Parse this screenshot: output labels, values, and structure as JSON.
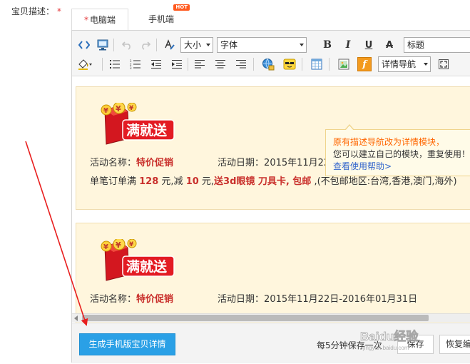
{
  "field": {
    "label": "宝贝描述：",
    "required_mark": "*"
  },
  "tabs": [
    {
      "label": "电脑端",
      "required_mark": "*",
      "active": true
    },
    {
      "label": "手机端",
      "badge": "HOT",
      "active": false
    }
  ],
  "toolbar": {
    "size_select": "大小",
    "font_select": "字体",
    "heading_select": "标题",
    "nav_select": "详情导航",
    "bold_label": "B",
    "italic_label": "I",
    "underline_label": "U",
    "strike_label": "A",
    "flash_label": "f"
  },
  "tooltip": {
    "line1": "原有描述导航改为详情模块，",
    "line2": "您可以建立自己的模块，重复使用！",
    "help_link": "查看使用帮助>"
  },
  "promos": [
    {
      "logo_text": "满就送",
      "name_label": "活动名称：",
      "name_value": "特价促销",
      "date_label": "活动日期：",
      "date_value": "2015年11月22日-2016年01月31日",
      "detail": {
        "p1": "单笔订单满 ",
        "amount": "128",
        "p2": " 元,减 ",
        "discount": "10",
        "p3": " 元,",
        "gift": "送3d眼镜 刀具卡, 包邮",
        "p4": " ,(不包邮地区:台湾,香港,澳门,海外)"
      }
    },
    {
      "logo_text": "满就送",
      "name_label": "活动名称：",
      "name_value": "特价促销",
      "date_label": "活动日期：",
      "date_value": "2015年11月22日-2016年01月31日"
    }
  ],
  "bottom": {
    "generate_button": "生成手机版宝贝详情",
    "autosave_text": "每5分钟保存一次",
    "save_button": "保存",
    "restore_button": "恢复编"
  },
  "watermark": {
    "text": "Baidu经验",
    "sub": "jingyan.baidu.com"
  },
  "colors": {
    "accent_blue": "#2aa0e6",
    "promo_bg": "#fff6dd",
    "promo_red": "#c9302c",
    "tip_orange": "#ff6600",
    "annotation_red": "#e81e1e"
  }
}
